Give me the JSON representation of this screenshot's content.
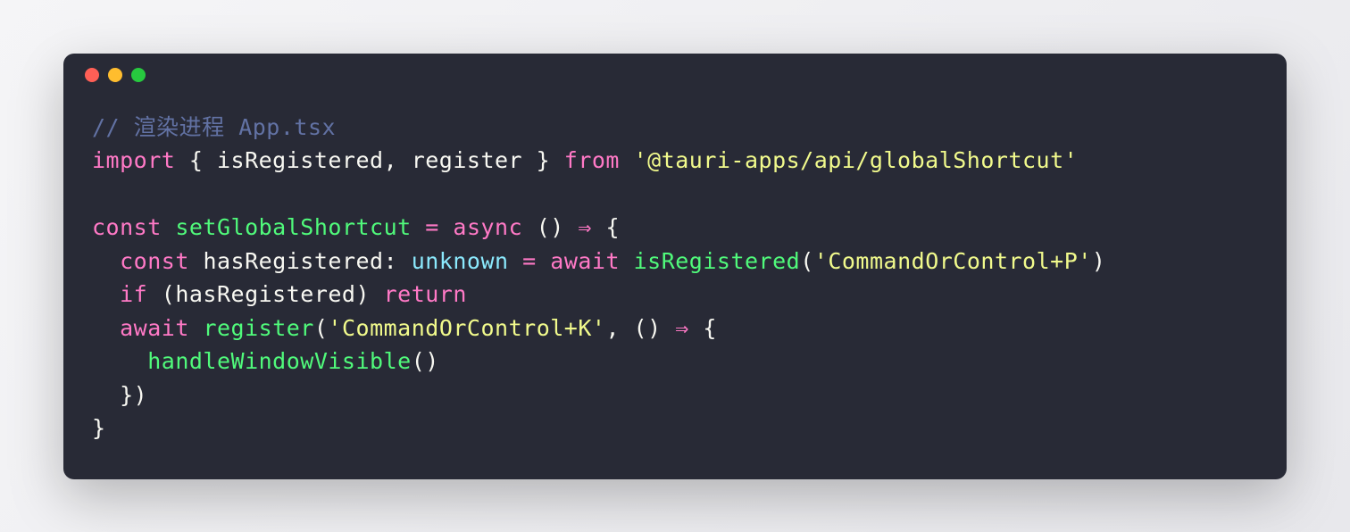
{
  "window": {
    "dots": [
      "red",
      "yellow",
      "green"
    ]
  },
  "code": {
    "tokens": [
      [
        {
          "t": "comment",
          "v": "// 渲染进程 App.tsx"
        }
      ],
      [
        {
          "t": "keyword",
          "v": "import"
        },
        {
          "t": "punct",
          "v": " { "
        },
        {
          "t": "ident",
          "v": "isRegistered"
        },
        {
          "t": "punct",
          "v": ", "
        },
        {
          "t": "ident",
          "v": "register"
        },
        {
          "t": "punct",
          "v": " } "
        },
        {
          "t": "keyword",
          "v": "from"
        },
        {
          "t": "punct",
          "v": " "
        },
        {
          "t": "string",
          "v": "'@tauri-apps/api/globalShortcut'"
        }
      ],
      [],
      [
        {
          "t": "keyword",
          "v": "const"
        },
        {
          "t": "punct",
          "v": " "
        },
        {
          "t": "func",
          "v": "setGlobalShortcut"
        },
        {
          "t": "punct",
          "v": " "
        },
        {
          "t": "keyword",
          "v": "="
        },
        {
          "t": "punct",
          "v": " "
        },
        {
          "t": "keyword",
          "v": "async"
        },
        {
          "t": "punct",
          "v": " () "
        },
        {
          "t": "keyword",
          "v": "⇒"
        },
        {
          "t": "punct",
          "v": " {"
        }
      ],
      [
        {
          "t": "punct",
          "v": "  "
        },
        {
          "t": "keyword",
          "v": "const"
        },
        {
          "t": "punct",
          "v": " "
        },
        {
          "t": "ident",
          "v": "hasRegistered"
        },
        {
          "t": "punct",
          "v": ": "
        },
        {
          "t": "type",
          "v": "unknown"
        },
        {
          "t": "punct",
          "v": " "
        },
        {
          "t": "keyword",
          "v": "="
        },
        {
          "t": "punct",
          "v": " "
        },
        {
          "t": "keyword",
          "v": "await"
        },
        {
          "t": "punct",
          "v": " "
        },
        {
          "t": "func",
          "v": "isRegistered"
        },
        {
          "t": "punct",
          "v": "("
        },
        {
          "t": "string",
          "v": "'CommandOrControl+P'"
        },
        {
          "t": "punct",
          "v": ")"
        }
      ],
      [
        {
          "t": "punct",
          "v": "  "
        },
        {
          "t": "keyword",
          "v": "if"
        },
        {
          "t": "punct",
          "v": " (hasRegistered) "
        },
        {
          "t": "keyword",
          "v": "return"
        }
      ],
      [
        {
          "t": "punct",
          "v": "  "
        },
        {
          "t": "keyword",
          "v": "await"
        },
        {
          "t": "punct",
          "v": " "
        },
        {
          "t": "func",
          "v": "register"
        },
        {
          "t": "punct",
          "v": "("
        },
        {
          "t": "string",
          "v": "'CommandOrControl+K'"
        },
        {
          "t": "punct",
          "v": ", () "
        },
        {
          "t": "keyword",
          "v": "⇒"
        },
        {
          "t": "punct",
          "v": " {"
        }
      ],
      [
        {
          "t": "punct",
          "v": "    "
        },
        {
          "t": "func",
          "v": "handleWindowVisible"
        },
        {
          "t": "punct",
          "v": "()"
        }
      ],
      [
        {
          "t": "punct",
          "v": "  })"
        }
      ],
      [
        {
          "t": "punct",
          "v": "}"
        }
      ]
    ]
  }
}
